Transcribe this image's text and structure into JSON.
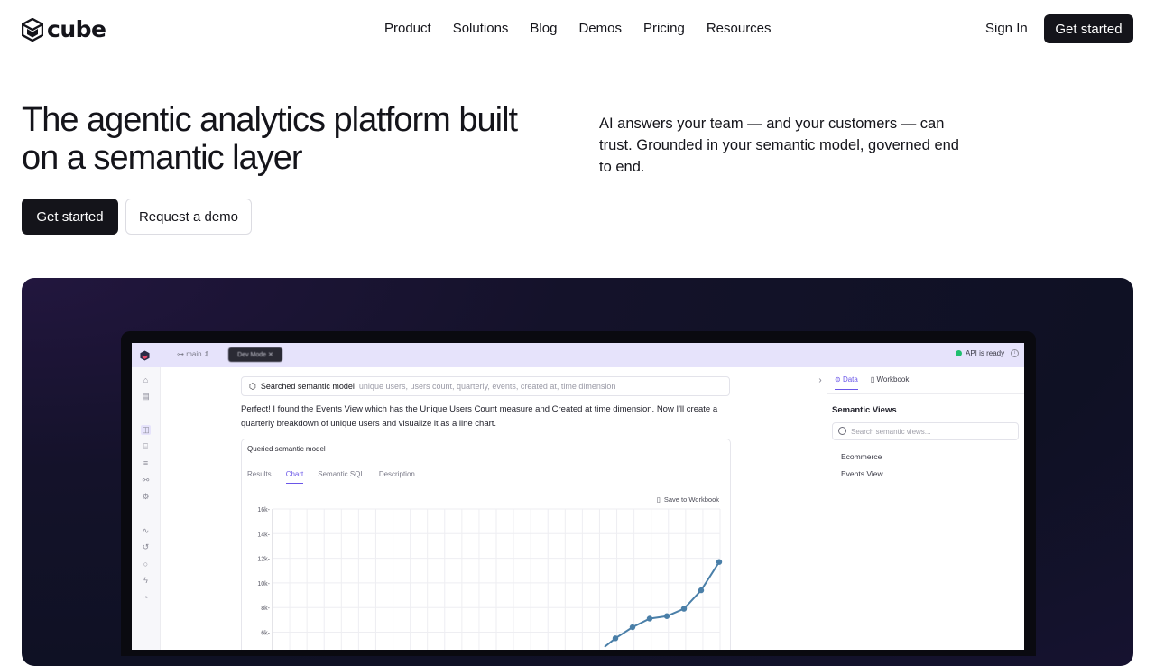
{
  "header": {
    "brand": "cube",
    "nav": [
      "Product",
      "Solutions",
      "Blog",
      "Demos",
      "Pricing",
      "Resources"
    ],
    "sign_in": "Sign In",
    "cta": "Get started"
  },
  "hero": {
    "title": "The agentic analytics platform built on a semantic layer",
    "subtitle": "AI answers your team — and your customers — can trust. Grounded in your semantic model, governed end to end.",
    "primary_cta": "Get started",
    "secondary_cta": "Request a demo"
  },
  "app": {
    "branch": "main",
    "dev_mode": "Dev Mode",
    "api_status": "API is ready",
    "searched_label": "Searched semantic model",
    "searched_terms": "unique users, users count, quarterly, events, created at, time dimension",
    "message": "Perfect! I found the Events View which has the Unique Users Count measure and Created at time dimension. Now I'll create a quarterly breakdown of unique users and visualize it as a line chart.",
    "card_title": "Queried semantic model",
    "tabs": [
      "Results",
      "Chart",
      "Semantic SQL",
      "Description"
    ],
    "active_tab": "Chart",
    "save_label": "Save to Workbook",
    "right_tabs": [
      "Data",
      "Workbook"
    ],
    "semantic_views_title": "Semantic Views",
    "search_placeholder": "Search semantic views...",
    "views": [
      "Ecommerce",
      "Events View"
    ]
  },
  "colors": {
    "accent": "#6a56e8",
    "line": "#4a7fa8",
    "status_ok": "#1fbf6e"
  },
  "chart_data": {
    "type": "line",
    "title": "",
    "xlabel": "",
    "ylabel": "",
    "y_ticks": [
      "16k",
      "14k",
      "12k",
      "10k",
      "8k",
      "6k"
    ],
    "ylim": [
      0,
      16000
    ],
    "grid": true,
    "series": [
      {
        "values": [
          5500,
          6400,
          7100,
          7300,
          7900,
          9400,
          11700
        ]
      }
    ]
  }
}
